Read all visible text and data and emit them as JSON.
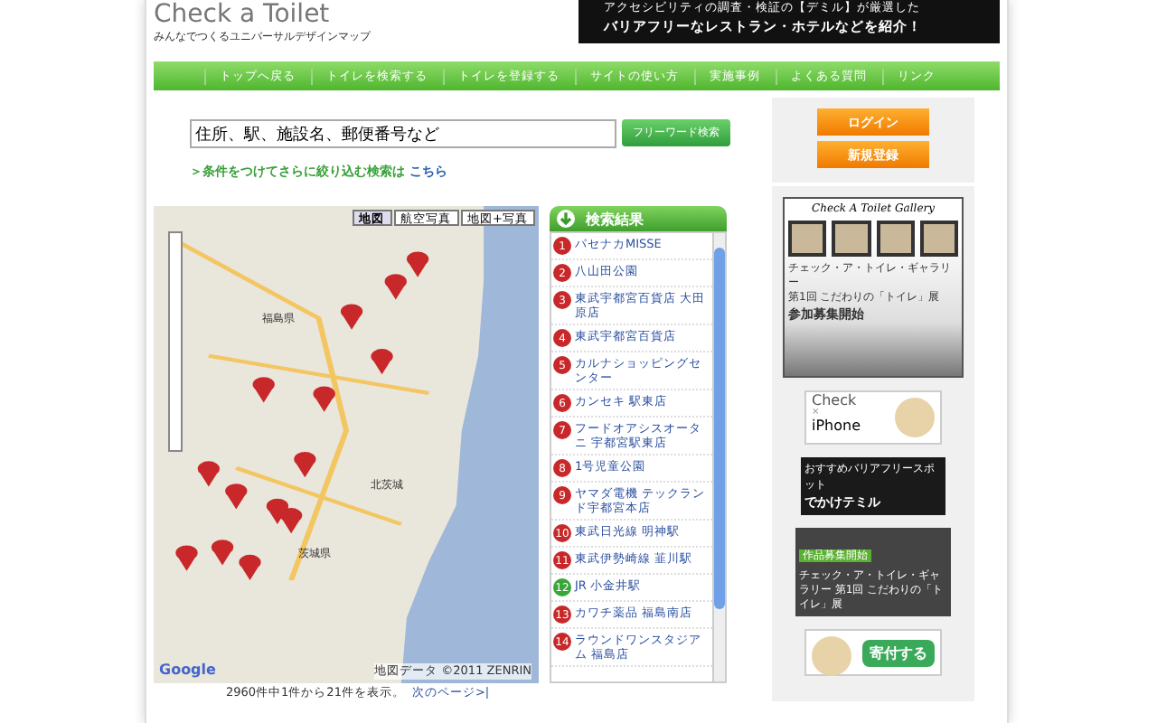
{
  "header": {
    "logo": "Check a Toilet",
    "tagline": "みんなでつくるユニバーサルデザインマップ",
    "banner_line1": "アクセシビリティの調査・検証の【デミル】が厳選した",
    "banner_line2": "バリアフリーなレストラン・ホテルなどを紹介！"
  },
  "nav": [
    "トップへ戻る",
    "トイレを検索する",
    "トイレを登録する",
    "サイトの使い方",
    "実施事例",
    "よくある質問",
    "リンク"
  ],
  "search": {
    "value": "住所、駅、施設名、郵便番号など",
    "button": "フリーワード検索",
    "hint": "＞条件をつけてさらに絞り込む検索は",
    "hint_link": "こちら"
  },
  "map": {
    "tabs": [
      {
        "label": "地図",
        "selected": true
      },
      {
        "label": "航空写真",
        "selected": false
      },
      {
        "label": "地図+写真",
        "selected": false
      }
    ],
    "places": [
      "福島県",
      "北茨城",
      "茨城県"
    ],
    "attribution": "地図データ ©2011 ZENRIN",
    "google": "Google"
  },
  "results": {
    "title": "検索結果",
    "items": [
      {
        "num": "1",
        "name": "パセナカMISSE",
        "color": "#c8282a"
      },
      {
        "num": "2",
        "name": "八山田公園",
        "color": "#c8282a"
      },
      {
        "num": "3",
        "name": "東武宇都宮百貨店 大田原店",
        "color": "#c8282a"
      },
      {
        "num": "4",
        "name": "東武宇都宮百貨店",
        "color": "#c8282a"
      },
      {
        "num": "5",
        "name": "カルナショッピングセンター",
        "color": "#c8282a"
      },
      {
        "num": "6",
        "name": "カンセキ 駅東店",
        "color": "#c8282a"
      },
      {
        "num": "7",
        "name": "フードオアシスオータニ 宇都宮駅東店",
        "color": "#c8282a"
      },
      {
        "num": "8",
        "name": "1号児童公園",
        "color": "#c8282a"
      },
      {
        "num": "9",
        "name": "ヤマダ電機 テックランド宇都宮本店",
        "color": "#c8282a"
      },
      {
        "num": "10",
        "name": "東武日光線 明神駅",
        "color": "#c8282a"
      },
      {
        "num": "11",
        "name": "東武伊勢崎線 韮川駅",
        "color": "#c8282a"
      },
      {
        "num": "12",
        "name": "JR 小金井駅",
        "color": "#3aa63a"
      },
      {
        "num": "13",
        "name": "カワチ薬品 福島南店",
        "color": "#c8282a"
      },
      {
        "num": "14",
        "name": "ラウンドワンスタジアム 福島店",
        "color": "#c8282a"
      }
    ]
  },
  "pager": {
    "summary": "2960件中1件から21件を表示。",
    "next": "次のページ>|"
  },
  "sidebar": {
    "login": "ログイン",
    "register": "新規登録",
    "gallery": {
      "title": "Check A Toilet Gallery",
      "line1": "チェック・ア・トイレ・ギャラリー",
      "line2": "第1回 こだわりの「トイレ」展",
      "line3": "参加募集開始"
    },
    "iphone": {
      "check": "Check",
      "x": "×",
      "iphone": "iPhone"
    },
    "demiru": {
      "small": "おすすめバリアフリースポット",
      "big": "でかけテミル"
    },
    "gallery_small": {
      "tag": "作品募集開始",
      "text": "チェック・ア・トイレ・ギャラリー 第1回 こだわりの「トイレ」展"
    },
    "donate": "寄付する"
  }
}
